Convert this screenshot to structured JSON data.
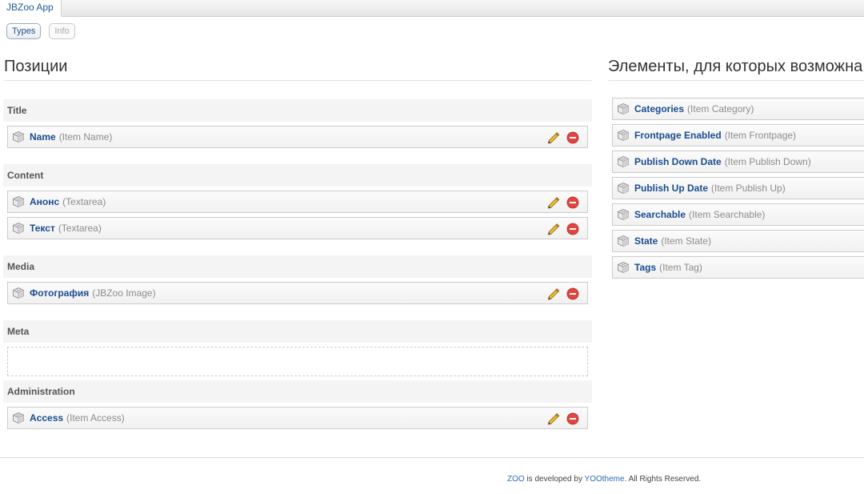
{
  "app_tab": "JBZoo App",
  "subtabs": {
    "types": "Types",
    "info": "Info"
  },
  "left": {
    "title": "Позиции",
    "positions": [
      {
        "name": "Title",
        "elements": [
          {
            "name": "Name",
            "type": "(Item Name)"
          }
        ]
      },
      {
        "name": "Content",
        "elements": [
          {
            "name": "Анонс",
            "type": "(Textarea)"
          },
          {
            "name": "Текст",
            "type": "(Textarea)"
          }
        ]
      },
      {
        "name": "Media",
        "elements": [
          {
            "name": "Фотография",
            "type": "(JBZoo Image)"
          }
        ]
      },
      {
        "name": "Meta",
        "elements": []
      },
      {
        "name": "Administration",
        "elements": [
          {
            "name": "Access",
            "type": "(Item Access)"
          }
        ]
      }
    ]
  },
  "right": {
    "title": "Элементы, для которых возможна н",
    "elements": [
      {
        "name": "Categories",
        "type": "(Item Category)"
      },
      {
        "name": "Frontpage Enabled",
        "type": "(Item Frontpage)"
      },
      {
        "name": "Publish Down Date",
        "type": "(Item Publish Down)"
      },
      {
        "name": "Publish Up Date",
        "type": "(Item Publish Up)"
      },
      {
        "name": "Searchable",
        "type": "(Item Searchable)"
      },
      {
        "name": "State",
        "type": "(Item State)"
      },
      {
        "name": "Tags",
        "type": "(Item Tag)"
      }
    ]
  },
  "footer": {
    "zoo_link": "ZOO",
    "developed_by": " is developed by ",
    "yootheme_link": "YOOtheme",
    "rights": ". All Rights Reserved."
  },
  "icons": {
    "element": "cube-icon",
    "edit": "pencil-icon",
    "delete": "remove-icon"
  },
  "colors": {
    "link": "#1a4c8f",
    "type_text": "#8c8c8c",
    "delete": "#d9322b",
    "edit": "#e7b42a"
  }
}
